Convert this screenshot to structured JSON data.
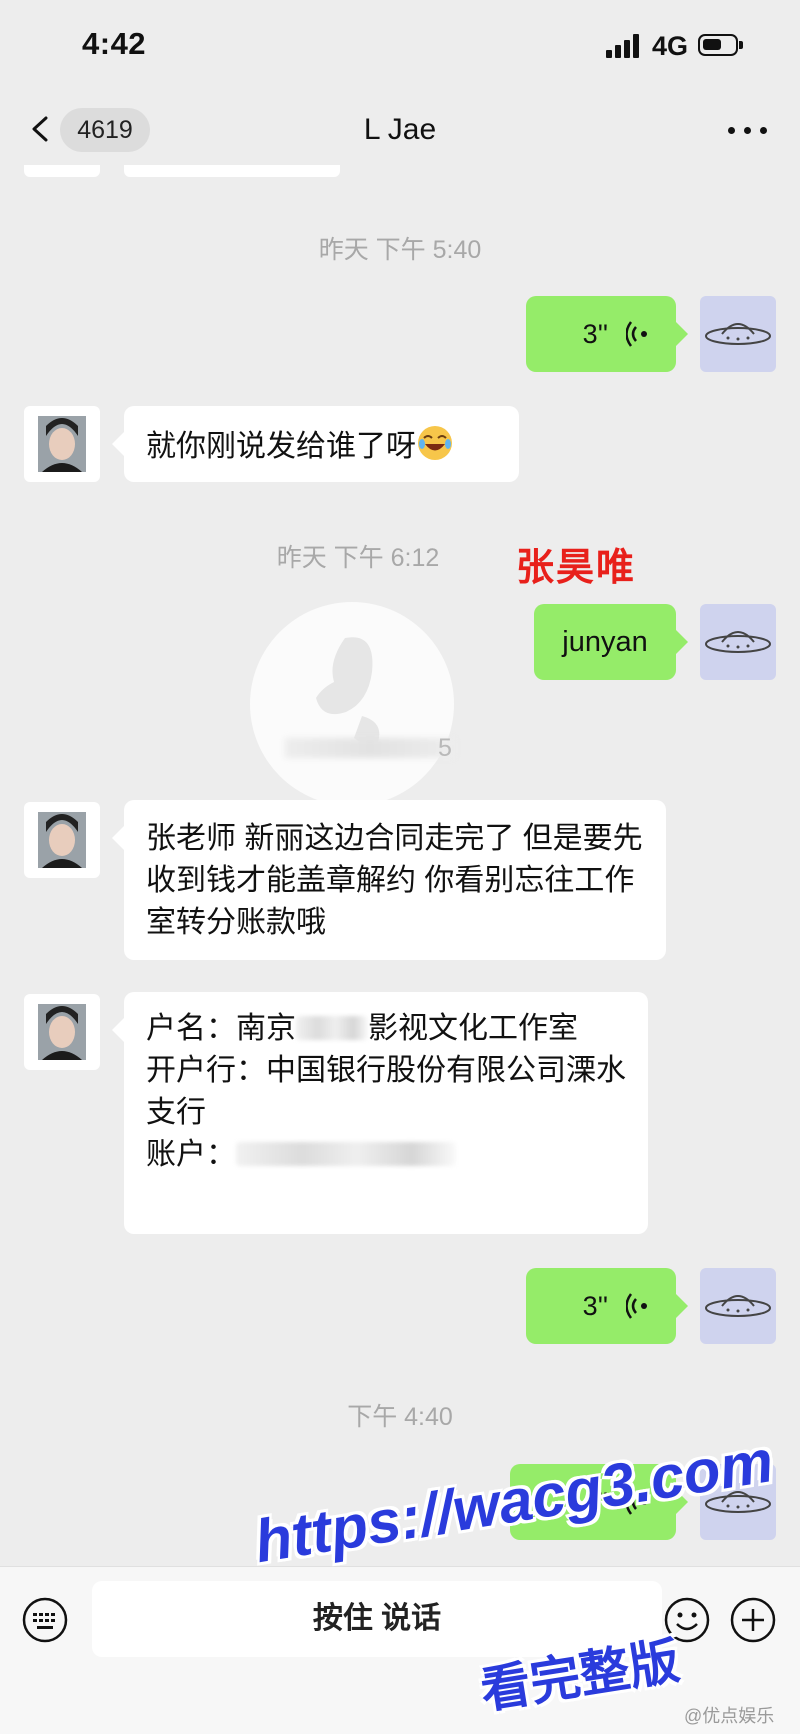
{
  "status": {
    "time": "4:42",
    "network": "4G"
  },
  "nav": {
    "unread_count": "4619",
    "title": "L Jae"
  },
  "messages": [
    {
      "timestamp": "昨天 下午 5:40"
    },
    {
      "voice_1": "3''"
    },
    {
      "text_1": "就你刚说发给谁了呀"
    },
    {
      "timestamp": "昨天 下午 6:12"
    },
    {
      "text_2": "junyan"
    }
  ],
  "chat": {
    "ts1": "昨天 下午 5:40",
    "voice1": "3''",
    "msg1": "就你刚说发给谁了呀",
    "ts2": "昨天 下午 6:12",
    "out_text": "junyan",
    "ts3_tail": "5",
    "msg2": "张老师 新丽这边合同走完了 但是要先收到钱才能盖章解约 你看别忘往工作室转分账款哦",
    "acct_name_label": "户名：南京",
    "acct_name_tail": "影视文化工作室",
    "bank": "开户行：中国银行股份有限公司溧水支行",
    "acct_label": "账户：",
    "voice2": "3''",
    "ts4": "下午 4:40",
    "voice3": "4''"
  },
  "overlay": {
    "name_tag": "张昊唯",
    "promo_url": "https://wacg3.com",
    "promo_text": "看完整版",
    "source": "@优点娱乐"
  },
  "input": {
    "hold_to_talk": "按住 说话"
  },
  "colors": {
    "outgoing_bubble": "#95ec69",
    "background": "#ededed",
    "name_tag": "#e8201b",
    "promo": "#2a3bdc"
  },
  "icons": [
    "back-chevron-icon",
    "more-dots-icon",
    "voice-wave-icon",
    "keyboard-icon",
    "emoji-icon",
    "plus-icon",
    "laughing-emoji-icon"
  ]
}
